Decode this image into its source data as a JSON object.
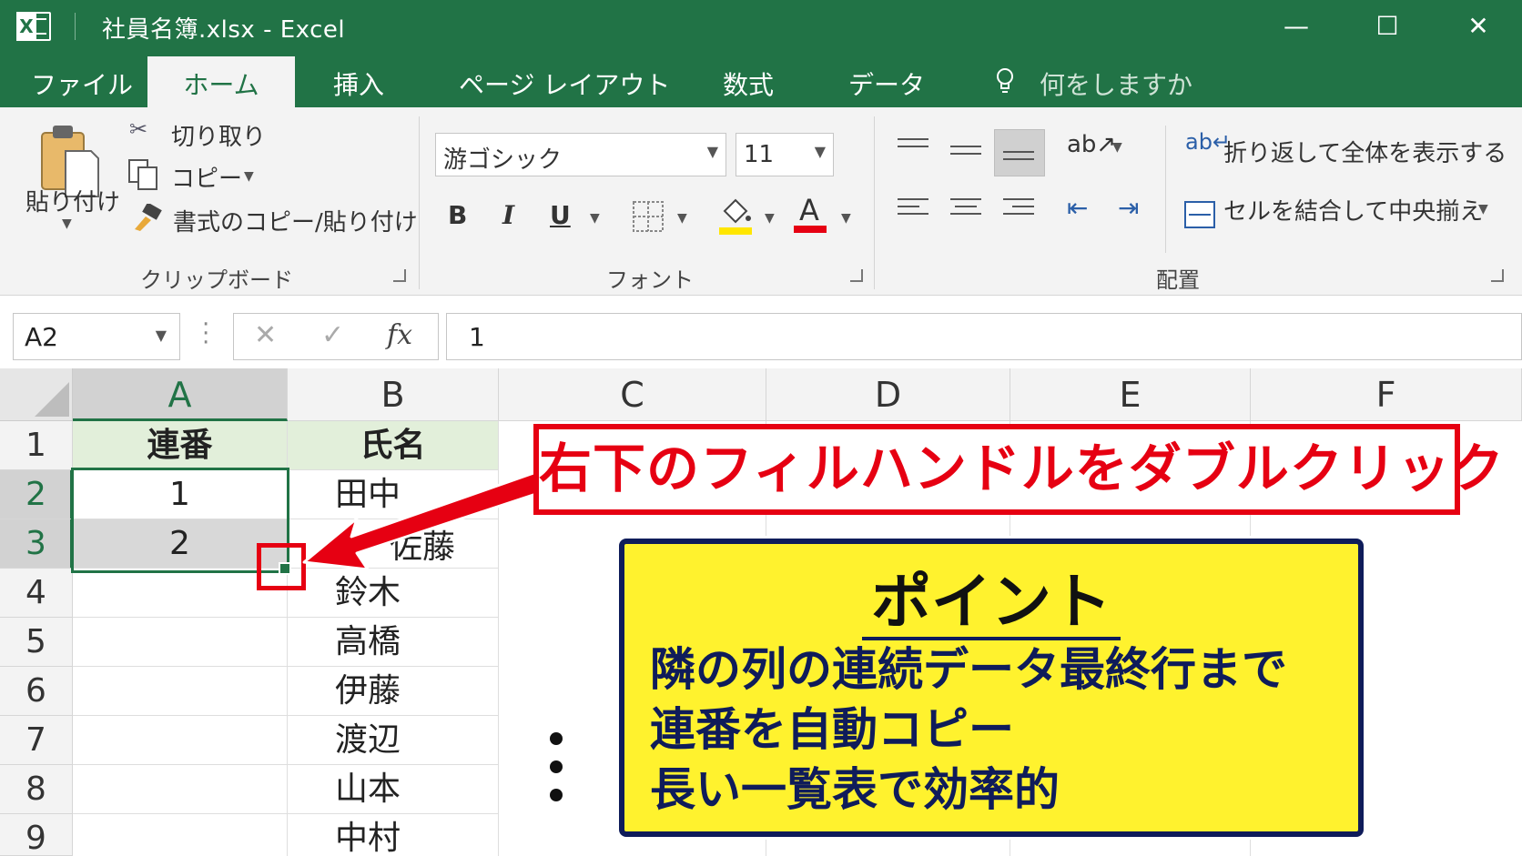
{
  "window": {
    "title": "社員名簿.xlsx  -  Excel",
    "app_icon": "excel-icon",
    "minimize": "—",
    "maximize": "☐",
    "close": "✕"
  },
  "tabs": [
    "ファイル",
    "ホーム",
    "挿入",
    "ページ レイアウト",
    "数式",
    "データ"
  ],
  "active_tab": "ホーム",
  "tell_me": "何をしますか",
  "clipboard": {
    "paste": "貼り付け",
    "cut": "切り取り",
    "copy": "コピー",
    "format_painter": "書式のコピー/貼り付け",
    "group": "クリップボード"
  },
  "font": {
    "name": "游ゴシック",
    "size": "11",
    "bold": "B",
    "italic": "I",
    "underline": "U",
    "font_color_glyph": "A",
    "group": "フォント",
    "highlight_color": "#ffe600",
    "font_color": "#e60012"
  },
  "alignment": {
    "wrap_text": "折り返して全体を表示する",
    "merge_center": "セルを結合して中央揃え",
    "group": "配置"
  },
  "formula_bar": {
    "name_box": "A2",
    "cancel": "✕",
    "enter": "✓",
    "fx": "fx",
    "value": "1"
  },
  "columns": [
    "A",
    "B",
    "C",
    "D",
    "E",
    "F"
  ],
  "rows": [
    "1",
    "2",
    "3",
    "4",
    "5",
    "6",
    "7",
    "8",
    "9"
  ],
  "sheet": {
    "a1": "連番",
    "b1": "氏名",
    "a2": "1",
    "a3": "2",
    "names": [
      "田中",
      "佐藤",
      "鈴木",
      "高橋",
      "伊藤",
      "渡辺",
      "山本",
      "中村"
    ]
  },
  "callout": {
    "instruction": "右下のフィルハンドルをダブルクリック"
  },
  "point": {
    "title": "ポイント",
    "lines": [
      "隣の列の連続データ最終行まで",
      "連番を自動コピー",
      "長い一覧表で効率的"
    ]
  },
  "colors": {
    "excel_green": "#217346",
    "callout_red": "#e60012",
    "point_yellow": "#fff22e",
    "point_navy": "#0f1c5a"
  }
}
